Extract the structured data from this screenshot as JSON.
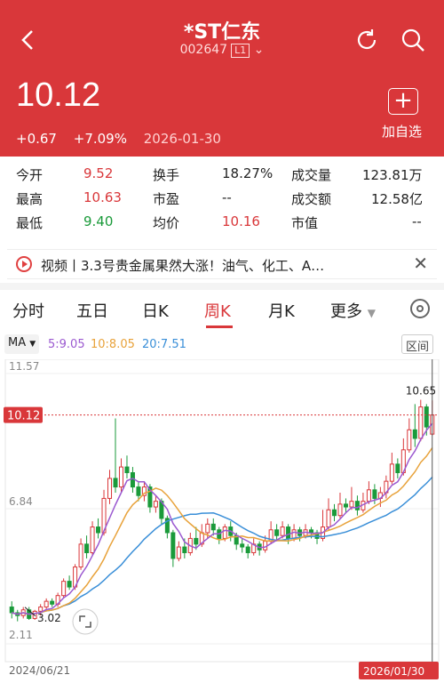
{
  "header": {
    "title": "*ST仁东",
    "code": "002647",
    "level": "L1",
    "price": "10.12",
    "change": "+0.67",
    "change_pct": "+7.09%",
    "date": "2026-01-30",
    "add_label": "加自选"
  },
  "stats": [
    [
      {
        "label": "今开",
        "value": "9.52",
        "color": "#d9373a"
      },
      {
        "label": "换手",
        "value": "18.27%",
        "color": "#222"
      },
      {
        "label": "成交量",
        "value": "123.81万",
        "color": "#222"
      }
    ],
    [
      {
        "label": "最高",
        "value": "10.63",
        "color": "#d9373a"
      },
      {
        "label": "市盈",
        "value": "--",
        "color": "#222"
      },
      {
        "label": "成交额",
        "value": "12.58亿",
        "color": "#222"
      }
    ],
    [
      {
        "label": "最低",
        "value": "9.40",
        "color": "#1a9a3a"
      },
      {
        "label": "均价",
        "value": "10.16",
        "color": "#d9373a"
      },
      {
        "label": "市值",
        "value": "--",
        "color": "#222"
      }
    ]
  ],
  "news": {
    "text": "视频丨3.3号贵金属果然大涨！油气、化工、A…"
  },
  "tabs": [
    "分时",
    "五日",
    "日K",
    "周K",
    "月K",
    "更多"
  ],
  "active_tab": "周K",
  "ma": {
    "label": "MA",
    "ma5": "5:9.05",
    "ma10": "10:8.05",
    "ma20": "20:7.51",
    "interval": "区间"
  },
  "colors": {
    "up": "#d9373a",
    "down": "#1a9a3a",
    "ma5": "#9b59d0",
    "ma10": "#e8a23a",
    "ma20": "#3a8fd8"
  },
  "chart_data": {
    "type": "candlestick",
    "y_labels": [
      "11.57",
      "6.84",
      "2.11"
    ],
    "current_price_label": "10.12",
    "high_annotation": "10.65",
    "low_annotation": "3.02",
    "start_date": "2024/06/21",
    "end_date": "2026/01/30",
    "ylim": [
      2.11,
      11.57
    ],
    "candles": [
      [
        3.4,
        3.2,
        3.6,
        3.0
      ],
      [
        3.2,
        3.1,
        3.3,
        2.9
      ],
      [
        3.1,
        3.3,
        3.4,
        3.0
      ],
      [
        3.3,
        3.0,
        3.4,
        2.95
      ],
      [
        3.0,
        3.25,
        3.3,
        2.95
      ],
      [
        3.25,
        3.4,
        3.5,
        3.1
      ],
      [
        3.4,
        3.6,
        3.7,
        3.3
      ],
      [
        3.6,
        3.5,
        3.7,
        3.4
      ],
      [
        3.5,
        3.8,
        3.9,
        3.4
      ],
      [
        3.8,
        4.3,
        4.4,
        3.7
      ],
      [
        4.3,
        4.1,
        4.5,
        4.0
      ],
      [
        4.1,
        4.8,
        4.9,
        4.0
      ],
      [
        4.8,
        5.6,
        5.8,
        4.7
      ],
      [
        5.6,
        5.3,
        5.9,
        5.1
      ],
      [
        5.3,
        6.2,
        6.4,
        5.2
      ],
      [
        6.2,
        6.0,
        6.5,
        5.8
      ],
      [
        6.0,
        7.2,
        7.5,
        5.9
      ],
      [
        7.2,
        7.9,
        8.2,
        7.0
      ],
      [
        7.9,
        7.6,
        10.0,
        7.4
      ],
      [
        7.6,
        8.3,
        8.6,
        7.4
      ],
      [
        8.3,
        8.1,
        8.7,
        7.9
      ],
      [
        8.1,
        7.6,
        8.3,
        7.4
      ],
      [
        7.6,
        7.3,
        7.8,
        7.1
      ],
      [
        7.3,
        7.6,
        7.8,
        7.1
      ],
      [
        7.6,
        6.9,
        7.7,
        6.7
      ],
      [
        6.9,
        7.1,
        7.3,
        6.7
      ],
      [
        7.1,
        6.5,
        7.2,
        6.3
      ],
      [
        6.5,
        6.0,
        6.6,
        5.8
      ],
      [
        6.0,
        5.1,
        6.1,
        4.8
      ],
      [
        5.1,
        5.5,
        5.7,
        5.0
      ],
      [
        5.5,
        5.3,
        5.8,
        5.1
      ],
      [
        5.3,
        5.8,
        6.0,
        5.2
      ],
      [
        5.8,
        5.6,
        6.2,
        5.4
      ],
      [
        5.6,
        6.0,
        6.3,
        5.5
      ],
      [
        6.0,
        6.3,
        6.5,
        5.8
      ],
      [
        6.3,
        6.1,
        6.5,
        5.9
      ],
      [
        6.1,
        5.8,
        6.2,
        5.6
      ],
      [
        5.8,
        6.2,
        6.3,
        5.7
      ],
      [
        6.2,
        5.9,
        6.4,
        5.7
      ],
      [
        5.9,
        5.6,
        6.0,
        5.4
      ],
      [
        5.6,
        5.5,
        5.8,
        5.3
      ],
      [
        5.5,
        5.3,
        5.6,
        5.1
      ],
      [
        5.3,
        5.6,
        5.8,
        5.2
      ],
      [
        5.6,
        5.4,
        5.7,
        5.2
      ],
      [
        5.4,
        5.7,
        5.9,
        5.3
      ],
      [
        5.7,
        6.1,
        6.4,
        5.6
      ],
      [
        6.1,
        5.9,
        6.3,
        5.7
      ],
      [
        5.9,
        6.2,
        6.4,
        5.8
      ],
      [
        6.2,
        5.8,
        6.3,
        5.6
      ],
      [
        5.8,
        6.1,
        6.3,
        5.7
      ],
      [
        6.1,
        5.9,
        6.2,
        5.7
      ],
      [
        5.9,
        6.1,
        6.3,
        5.8
      ],
      [
        6.1,
        6.0,
        6.2,
        5.8
      ],
      [
        6.0,
        5.8,
        6.1,
        5.6
      ],
      [
        5.8,
        6.2,
        6.8,
        5.7
      ],
      [
        6.2,
        6.8,
        7.2,
        6.1
      ],
      [
        6.8,
        6.6,
        7.0,
        6.4
      ],
      [
        6.6,
        7.0,
        7.4,
        6.5
      ],
      [
        7.0,
        6.9,
        7.2,
        6.7
      ],
      [
        6.9,
        7.1,
        7.6,
        6.8
      ],
      [
        7.1,
        6.8,
        7.3,
        6.6
      ],
      [
        6.8,
        7.1,
        7.4,
        6.7
      ],
      [
        7.1,
        7.5,
        7.8,
        7.0
      ],
      [
        7.5,
        7.2,
        7.7,
        7.0
      ],
      [
        7.2,
        7.4,
        7.6,
        6.9
      ],
      [
        7.4,
        7.8,
        8.0,
        7.2
      ],
      [
        7.8,
        8.4,
        8.8,
        7.7
      ],
      [
        8.4,
        8.1,
        8.6,
        7.9
      ],
      [
        8.1,
        8.9,
        9.3,
        8.0
      ],
      [
        8.9,
        9.6,
        10.0,
        8.8
      ],
      [
        9.6,
        9.3,
        10.5,
        9.0
      ],
      [
        9.3,
        10.4,
        10.65,
        9.2
      ],
      [
        10.4,
        9.7,
        10.5,
        9.4
      ],
      [
        9.45,
        10.12,
        10.63,
        9.4
      ]
    ]
  }
}
